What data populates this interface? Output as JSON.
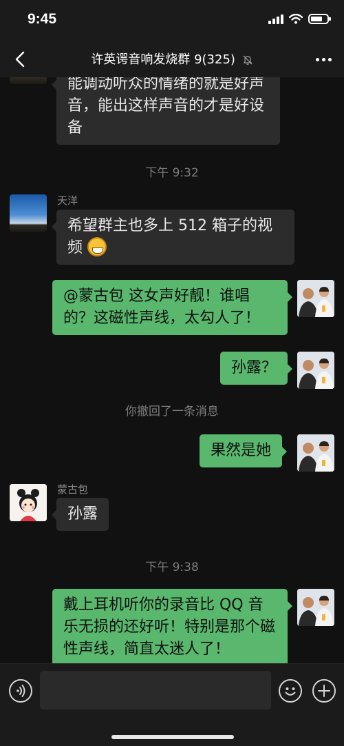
{
  "status_bar": {
    "time": "9:45"
  },
  "header": {
    "title": "许英谔音响发烧群 9(325)"
  },
  "messages": [
    {
      "sender": "",
      "text": "能调动听众的情绪的就是好声音，能出这样声音的才是好设备"
    },
    {
      "type": "time",
      "text": "下午 9:32"
    },
    {
      "sender": "天洋",
      "text": "希望群主也多上 512 箱子的视频"
    },
    {
      "sender": "me",
      "text": "@蒙古包 这女声好靓！谁唱的？这磁性声线，太勾人了！"
    },
    {
      "sender": "me",
      "text": "孙露？"
    },
    {
      "type": "system",
      "text": "你撤回了一条消息"
    },
    {
      "sender": "me",
      "text": "果然是她"
    },
    {
      "sender": "蒙古包",
      "text": "孙露"
    },
    {
      "type": "time",
      "text": "下午 9:38"
    },
    {
      "sender": "me",
      "text": "戴上耳机听你的录音比 QQ 音乐无损的还好听！特别是那个磁性声线，简直太迷人了！"
    }
  ],
  "input": {
    "placeholder": ""
  },
  "colors": {
    "outgoing_bubble": "#59b86d",
    "incoming_bubble": "#2c2c2c",
    "background": "#111111"
  },
  "icons": {
    "back": "chevron-left-icon",
    "mute": "bell-off-icon",
    "more": "ellipsis-icon",
    "voice": "voice-icon",
    "emoji": "smile-icon",
    "plus": "plus-icon"
  }
}
